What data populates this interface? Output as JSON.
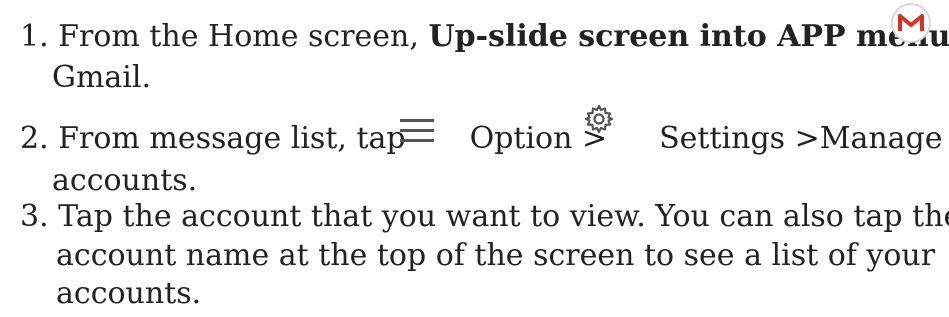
{
  "steps": [
    {
      "number": "1.",
      "text_a": "From the Home screen, ",
      "bold": "Up-slide screen into APP menu",
      "text_b": " >",
      "line2": "Gmail."
    },
    {
      "number": "2.",
      "text_a": "From message list, tap",
      "text_b": "Option >",
      "text_c": "Settings >Manage",
      "line2": "accounts."
    },
    {
      "number": "3.",
      "text_a": "Tap the account that you want to view. You can also tap the",
      "line2": "account name at the top of the screen to see a list of your",
      "line3": "accounts."
    }
  ],
  "icons": {
    "gmail": "gmail-icon",
    "menu": "menu-icon",
    "settings": "gear-icon"
  }
}
